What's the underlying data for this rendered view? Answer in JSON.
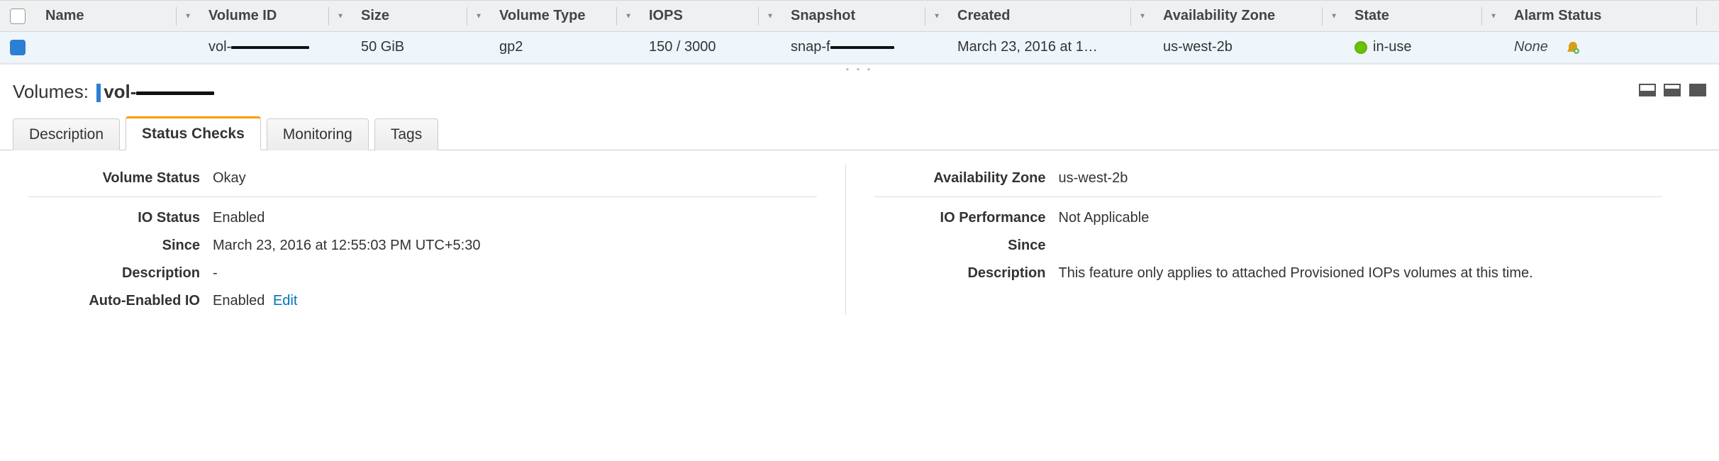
{
  "table": {
    "headers": {
      "name": "Name",
      "volume_id": "Volume ID",
      "size": "Size",
      "volume_type": "Volume Type",
      "iops": "IOPS",
      "snapshot": "Snapshot",
      "created": "Created",
      "az": "Availability Zone",
      "state": "State",
      "alarm": "Alarm Status"
    },
    "row": {
      "name": "",
      "volume_id_prefix": "vol-",
      "size": "50 GiB",
      "volume_type": "gp2",
      "iops": "150 / 3000",
      "snapshot_prefix": "snap-f",
      "created": "March 23, 2016 at 1…",
      "az": "us-west-2b",
      "state": "in-use",
      "alarm": "None"
    }
  },
  "detail": {
    "label": "Volumes:",
    "id_prefix": "vol-"
  },
  "tabs": {
    "description": "Description",
    "status_checks": "Status Checks",
    "monitoring": "Monitoring",
    "tags": "Tags"
  },
  "status": {
    "left": {
      "volume_status_k": "Volume Status",
      "volume_status_v": "Okay",
      "io_status_k": "IO Status",
      "io_status_v": "Enabled",
      "since_k": "Since",
      "since_v": "March 23, 2016 at 12:55:03 PM UTC+5:30",
      "description_k": "Description",
      "description_v": "-",
      "auto_enabled_k": "Auto-Enabled IO",
      "auto_enabled_v": "Enabled",
      "edit": "Edit"
    },
    "right": {
      "az_k": "Availability Zone",
      "az_v": "us-west-2b",
      "io_perf_k": "IO Performance",
      "io_perf_v": "Not Applicable",
      "since_k": "Since",
      "since_v": "",
      "description_k": "Description",
      "description_v": "This feature only applies to attached Provisioned IOPs volumes at this time."
    }
  }
}
